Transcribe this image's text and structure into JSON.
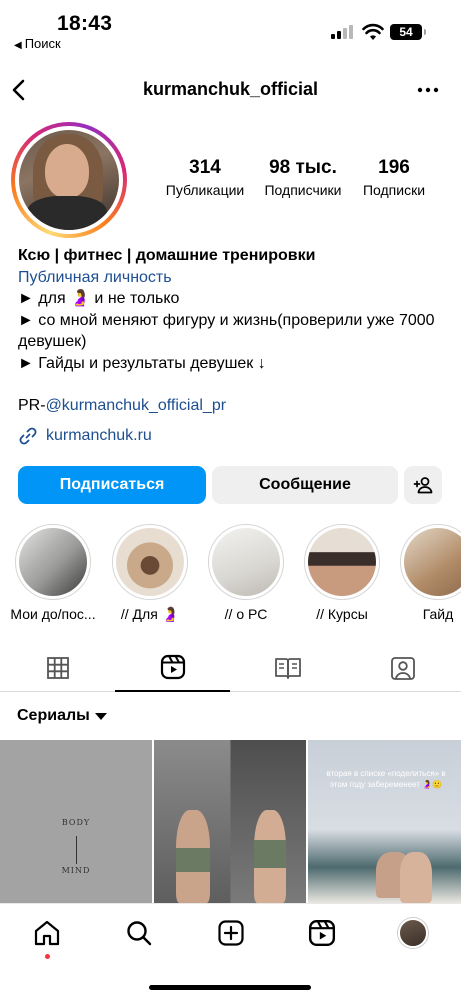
{
  "status_bar": {
    "time": "18:43",
    "back_app": "Поиск",
    "battery": "54"
  },
  "header": {
    "username": "kurmanchuk_official"
  },
  "stats": [
    {
      "value": "314",
      "label": "Публикации"
    },
    {
      "value": "98 тыс.",
      "label": "Подписчики"
    },
    {
      "value": "196",
      "label": "Подписки"
    }
  ],
  "bio": {
    "name": "Ксю | фитнес | домашние тренировки",
    "category": "Публичная личность",
    "line1": "► для 🤰 и не только",
    "line2": "► со мной меняют фигуру и жизнь(проверили уже 7000 девушек)",
    "line3": "► Гайды и результаты девушек ↓",
    "pr_prefix": "PR-",
    "pr_handle": "@kurmanchuk_official_pr",
    "website": "kurmanchuk.ru"
  },
  "buttons": {
    "follow": "Подписаться",
    "message": "Сообщение"
  },
  "highlights": [
    {
      "label": "Мои до/пос..."
    },
    {
      "label": "// Для 🤰"
    },
    {
      "label": "// о РС"
    },
    {
      "label": "// Курсы"
    },
    {
      "label": "Гайд"
    }
  ],
  "series": {
    "label": "Сериалы"
  },
  "grid": {
    "cell1_top": "BODY",
    "cell1_bottom": "MIND",
    "cell3_caption": "вторая в списке «поделиться» в этом году забеременеет 🤰🙂"
  },
  "colors": {
    "accent": "#0095f6",
    "link": "#1d4f91",
    "notification": "#ff3040"
  }
}
